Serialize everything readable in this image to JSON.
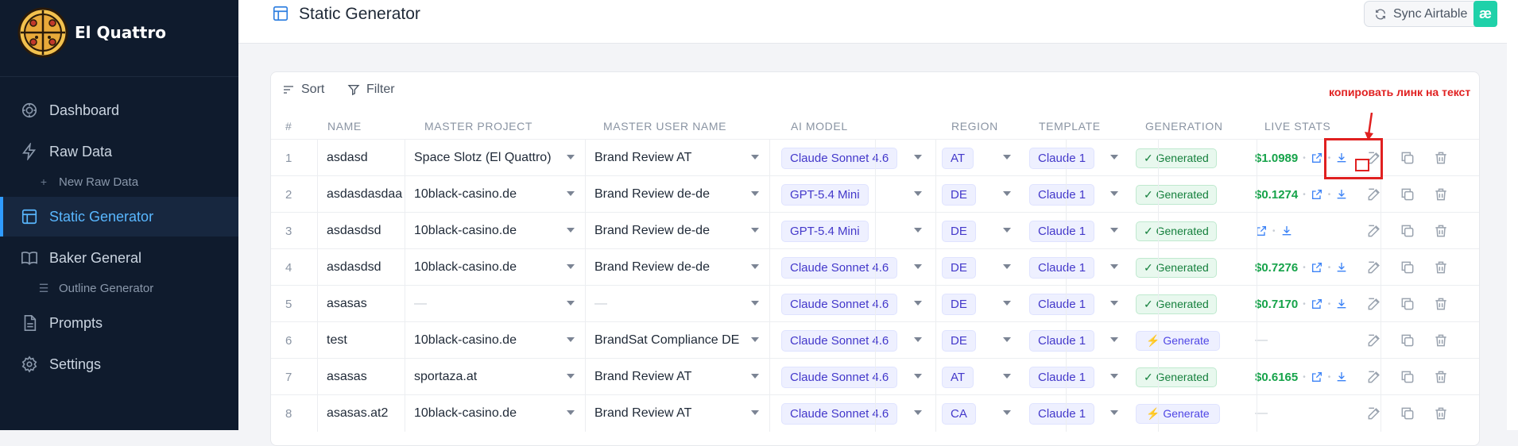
{
  "brand": {
    "name": "El Quattro"
  },
  "nav": {
    "items": [
      {
        "label": "Dashboard"
      },
      {
        "label": "Raw Data"
      },
      {
        "label": "Static Generator"
      },
      {
        "label": "Baker General"
      },
      {
        "label": "Prompts"
      },
      {
        "label": "Settings"
      }
    ],
    "sub_items": [
      {
        "label": "New Raw Data"
      },
      {
        "label": "Outline Generator"
      }
    ]
  },
  "header": {
    "title": "Static Generator",
    "sync_label": "Sync Airtable",
    "airtable_glyph": "æ"
  },
  "toolbar": {
    "sort_label": "Sort",
    "filter_label": "Filter"
  },
  "table": {
    "columns": [
      "#",
      "NAME",
      "MASTER PROJECT",
      "MASTER USER NAME",
      "AI MODEL",
      "REGION",
      "TEMPLATE",
      "GENERATION",
      "LIVE STATS"
    ],
    "rows": [
      {
        "num": "1",
        "name": "asdasd",
        "project": "Space Slotz (El Quattro)",
        "user": "Brand Review AT",
        "model": "Claude Sonnet 4.6",
        "region": "AT",
        "template": "Claude 1",
        "generation": "✓ Generated",
        "price": "$1.0989"
      },
      {
        "num": "2",
        "name": "asdasdasdaa",
        "project": "10black-casino.de",
        "user": "Brand Review de-de",
        "model": "GPT-5.4 Mini",
        "region": "DE",
        "template": "Claude 1",
        "generation": "✓ Generated",
        "price": "$0.1274"
      },
      {
        "num": "3",
        "name": "asdasdsd",
        "project": "10black-casino.de",
        "user": "Brand Review de-de",
        "model": "GPT-5.4 Mini",
        "region": "DE",
        "template": "Claude 1",
        "generation": "✓ Generated",
        "price": ""
      },
      {
        "num": "4",
        "name": "asdasdsd",
        "project": "10black-casino.de",
        "user": "Brand Review de-de",
        "model": "Claude Sonnet 4.6",
        "region": "DE",
        "template": "Claude 1",
        "generation": "✓ Generated",
        "price": "$0.7276"
      },
      {
        "num": "5",
        "name": "asasas",
        "project": "—",
        "user": "—",
        "model": "Claude Sonnet 4.6",
        "region": "DE",
        "template": "Claude 1",
        "generation": "✓ Generated",
        "price": "$0.7170"
      },
      {
        "num": "6",
        "name": "test",
        "project": "10black-casino.de",
        "user": "BrandSat Compliance DE",
        "model": "Claude Sonnet 4.6",
        "region": "DE",
        "template": "Claude 1",
        "generation": "⚡ Generate",
        "price": "—"
      },
      {
        "num": "7",
        "name": "asasas",
        "project": "sportaza.at",
        "user": "Brand Review AT",
        "model": "Claude Sonnet 4.6",
        "region": "AT",
        "template": "Claude 1",
        "generation": "✓ Generated",
        "price": "$0.6165"
      },
      {
        "num": "8",
        "name": "asasas.at2",
        "project": "10black-casino.de",
        "user": "Brand Review AT",
        "model": "Claude Sonnet 4.6",
        "region": "CA",
        "template": "Claude 1",
        "generation": "⚡ Generate",
        "price": "—"
      }
    ]
  },
  "annotation": {
    "text": "копировать линк на текст",
    "color": "#e02020"
  },
  "colors": {
    "sidebar_bg": "#0f1b2d",
    "accent": "#2f9bff",
    "success": "#16a34a"
  }
}
